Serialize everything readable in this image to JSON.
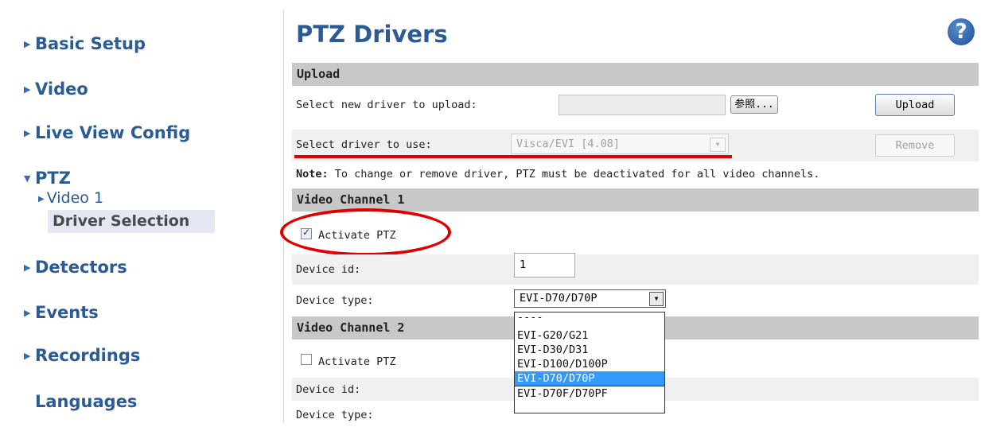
{
  "sidebar": {
    "items": [
      {
        "label": "Basic Setup"
      },
      {
        "label": "Video"
      },
      {
        "label": "Live View Config"
      },
      {
        "label": "PTZ"
      },
      {
        "label": "Detectors"
      },
      {
        "label": "Events"
      },
      {
        "label": "Recordings"
      },
      {
        "label": "Languages"
      }
    ],
    "ptz_sub": {
      "video": "Video 1",
      "driver": "Driver Selection"
    }
  },
  "header": {
    "title": "PTZ Drivers",
    "help": "?"
  },
  "upload": {
    "section": "Upload",
    "select_new_label": "Select new driver to upload:",
    "browse_label": "参照...",
    "upload_button": "Upload",
    "select_use_label": "Select driver to use:",
    "driver_value": "Visca/EVI [4.08]",
    "remove_button": "Remove",
    "note_bold": "Note:",
    "note_text": " To change or remove driver, PTZ must be deactivated for all video channels."
  },
  "channel1": {
    "section": "Video Channel 1",
    "activate_label": "Activate PTZ",
    "activate_checked": true,
    "device_id_label": "Device id:",
    "device_id_value": "1",
    "device_type_label": "Device type:",
    "device_type_value": "EVI-D70/D70P"
  },
  "channel2": {
    "section": "Video Channel 2",
    "activate_label": "Activate PTZ",
    "activate_checked": false,
    "device_id_label": "Device id:",
    "device_type_label": "Device type:"
  },
  "dropdown_options": [
    "----",
    "EVI-G20/G21",
    "EVI-D30/D31",
    "EVI-D100/D100P",
    "EVI-D70/D70P",
    "EVI-D70F/D70PF"
  ],
  "dropdown_selected": "EVI-D70/D70P",
  "colors": {
    "link": "#2a5b94",
    "highlight": "#3399ff",
    "annotation": "#e00000"
  }
}
